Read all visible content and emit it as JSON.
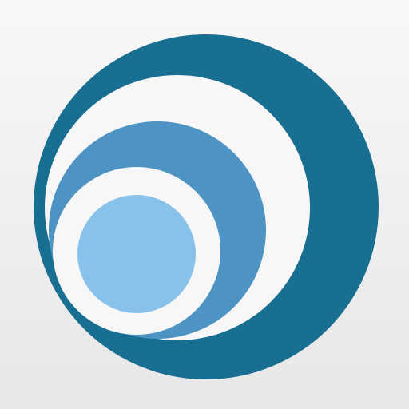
{
  "icon": {
    "logo_name": "concentric-crescent-logo",
    "colors": {
      "background_top": "#f8f8f8",
      "background_bottom": "#e7e7e7",
      "outer_ring": "#186f91",
      "middle_ring": "#4d93c3",
      "inner_disc": "#88c2eb",
      "gap": "#f7f7f7"
    }
  }
}
